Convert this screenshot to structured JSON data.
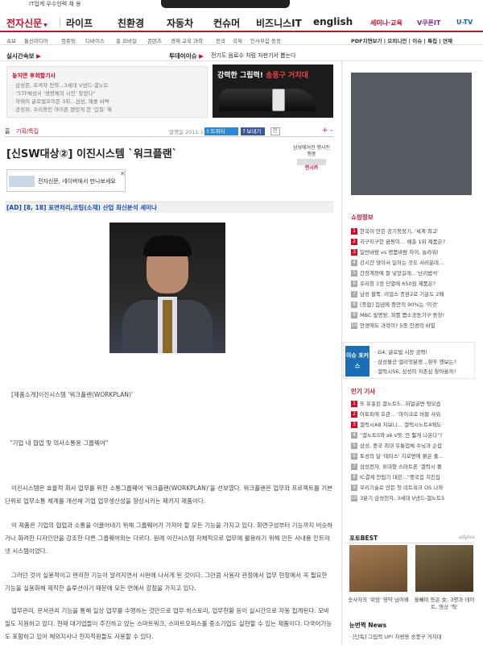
{
  "topstrip": {
    "text": "IT업계 우수인력 채 용"
  },
  "mainnav": {
    "logo": "전자신문",
    "items": [
      "라이프",
      "친환경",
      "자동차",
      "컨슈머",
      "비즈니스IT",
      "english"
    ],
    "right1": "세미나·교육",
    "right2": "V쿠폰IT",
    "right3": "U-TV"
  },
  "subnav": {
    "items": [
      "속보",
      "통신미디어",
      "컴퓨팅",
      "디바이스",
      "홈 모바일",
      "콘텐츠",
      "경제 교육 과학",
      "전국",
      "국제",
      "인사부음 동정"
    ],
    "right": "PDF지면보기 | 오피니언 | 이슈 | 특집 | 연재"
  },
  "live": {
    "label1": "실시간속보",
    "label2": "투데이이슈",
    "text": "전기도 음료수 처럼 자판기서 뽑는다"
  },
  "leftbox": {
    "head": "놓치면 후회할기사",
    "items": [
      "· 삼성폰, 초격차 전략…3세대 V낸드-갤노트",
      "· \"5TF체성서 '생명체의 시인' 찾았다\"",
      "· 하에이 글로벌호이즌 3위…삼성, 애플 바짝 ·",
      "· 공정위, 수리용인 아이폰 됐었게 한 '갑질' 해"
    ]
  },
  "ad1": {
    "text": "강력한 그립력!",
    "brand": "송풍구 거치대"
  },
  "crumb": {
    "home": "홈",
    "section": "기획/특집",
    "date": "발행일 2011.11.14",
    "twitter": "트위터",
    "facebook": "보내기",
    "print": "인",
    "zoom_in": "+",
    "zoom_out": "-"
  },
  "article": {
    "title": "[신SW대상②] 이진시스템 `워크플랜`",
    "ad_text": "삼성에어컨 행사진행중",
    "ad_brand": "전시카",
    "banner_text": "전자신문, 네이버에서 만나보세요",
    "ad_line": "[AD] [8, 18] 표면처리,코팅(소재) 산업 최신분석 세미나",
    "caption": "[제품소개]이진시스템 '워크플랜(WORKPLAN)'",
    "subtitle": "\"기업 내 협업 및 의사소통용 그룹웨어\"",
    "p1": "이진시스템은 효율적 회사 업무를 위한 소통그룹웨어 '워크플랜(WORKPLAN)'을 선보였다. 워크플랜은 업무와 프로젝트를 기본 단위로 업무소통 체계를 개선해 기업 업무생산성을 향상시키는 패키지 제품이다.",
    "p2": "이 제품은 기업의 협업과 소통을 이끌어내기 위해 그룹웨어가 가져야 할 모든 기능을 가지고 있다. 화면구성부터 기능까지 비슷하거나 화려한 디자인만을 강조한 다른 그룹웨어와는 다르다. 원래 이진시스템 자체적으로 업무에 활용하기 위해 만든 사내용 인트라넷 시스템이었다.",
    "p3": "그러던 것이 실용적이고 편리한 기능이 알려지면서 시판에 나서게 된 것이다. 그만큼 사용자 관점에서 업무 현장에서 꼭 필요한 기능을 실용화해 제작한 솔루션이기 때문에 모든 면에서 강점을 가지고 있다.",
    "p4": "업무관리, 문서관리 기능을 통해 일상 업무를 수행하는 것만으로 업무 히스토리, 업무현황 등이 실시간으로 자동 집계된다. 모바일도 지원하고 있다. 현재 대기업들이 추진하고 있는 스마트워크, 스마트오피스를 중소기업도 실현할 수 있는 제품이다. 다국어기능도 포함하고 있어 해외지사나 현지직원들도 사용할 수 있다."
  },
  "shop": {
    "head": "쇼핑정보",
    "items": [
      "한국이 만든 공기청정기, '세계 최고'",
      "지구지구한 곰팡이… 메출 1위 제품은?",
      "일반바람 vs 명품바람 차이, 놀라워!",
      "강시간 앉아서 일하는 것도 서러운데…",
      "간장계장에 잘 넣었길래…'난리법석'",
      "유리창 1장 단열에 650원 제품은?",
      "남성 팔뚝, 리얼스 종완2로 기운도 2배",
      "[종합] 집념에 중안의 90%는 '이것'",
      "MBC 발명왕, 피를 뽑소공동기구 등장!",
      "안경에도 과학이? 5종 안경의 비밀"
    ]
  },
  "focus": {
    "label": "이슈 포커스",
    "items": [
      "· G4, 글로벌 시장 공략!",
      "· 삼성물산·엘리엇분쟁…향후 행보는?",
      "· 갤럭시S6, 삼성의 자존심 찾아올까?"
    ]
  },
  "popular": {
    "head": "인기 기사",
    "items": [
      "또 유출된 갤노트5…뒤얼굴면 뒷모습",
      "아토피에 호관… '마이크로 버블 샤워",
      "갤럭시A8 처보니… 갤럭시노트4에도",
      "\"갤노트5와 s6 s엣, 안 훨게 나온다\"?",
      "삼성, 중국 최대 유통업체 수닝과 손잡",
      "토성의 달 '테티스' 지로면에 붉은 줄…",
      "삼성전자, 휴대형 스마트폰 '갤럭시 폴",
      "IC결제 안됩기 대란…\"중국집 치킨집",
      "우리기술로 만든 첫 네트워크 OS 나와",
      "3분기 삼성전자, 3세대 V낸드-갤노트5"
    ]
  },
  "photobest": {
    "head": "포토BEST",
    "source": "adplex",
    "cap1": "숫사자의 '위엄' 영약 넘어왜",
    "cap2": "올빼미 등은 女, 3명과 데이트, 영상 '헉'"
  },
  "nbest": {
    "head": "눈번쩍 News",
    "item": "· [단독] 그립력 UP! 차량용 송풍구 거치대"
  }
}
